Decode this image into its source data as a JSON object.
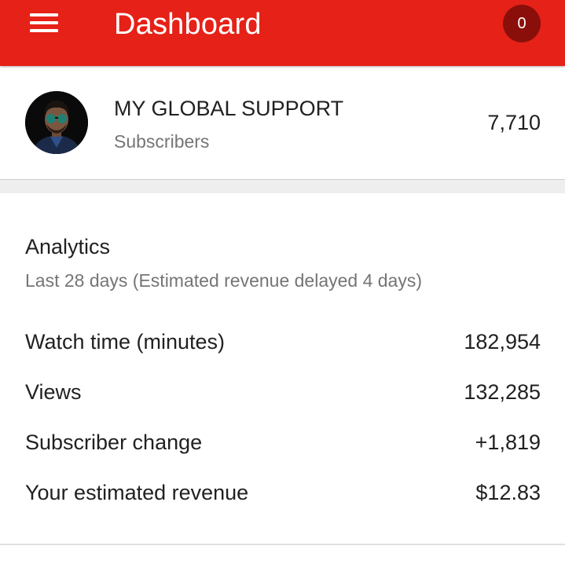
{
  "appbar": {
    "title": "Dashboard",
    "notification_count": "0",
    "background_color": "#e62117",
    "menu_icon": "hamburger-menu-icon"
  },
  "channel": {
    "name": "MY GLOBAL SUPPORT",
    "subscribers_label": "Subscribers",
    "subscribers_count": "7,710"
  },
  "analytics": {
    "title": "Analytics",
    "subtitle": "Last 28 days (Estimated revenue delayed 4 days)",
    "metrics": [
      {
        "label": "Watch time (minutes)",
        "value": "182,954"
      },
      {
        "label": "Views",
        "value": "132,285"
      },
      {
        "label": "Subscriber change",
        "value": "+1,819"
      },
      {
        "label": "Your estimated revenue",
        "value": "$12.83"
      }
    ]
  }
}
